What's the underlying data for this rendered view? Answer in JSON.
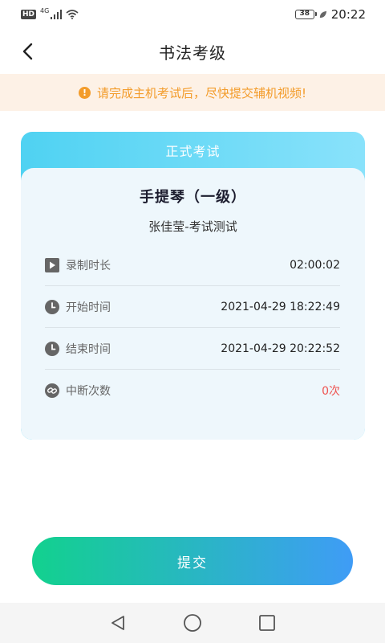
{
  "status_bar": {
    "hd": "HD",
    "network": "4G",
    "battery": "38",
    "time": "20:22"
  },
  "header": {
    "title": "书法考级",
    "back_icon": "chevron-left-icon"
  },
  "notice": {
    "icon": "!",
    "text": "请完成主机考试后，尽快提交辅机视频!",
    "color": "#f39c2b"
  },
  "card": {
    "header_title": "正式考试",
    "subject": "手提琴（一级）",
    "candidate": "张佳莹-考试测试",
    "rows": [
      {
        "icon": "play-icon",
        "label": "录制时长",
        "value": "02:00:02"
      },
      {
        "icon": "clock-icon",
        "label": "开始时间",
        "value": "2021-04-29 18:22:49"
      },
      {
        "icon": "clock-icon",
        "label": "结束时间",
        "value": "2021-04-29 20:22:52"
      },
      {
        "icon": "link-icon",
        "label": "中断次数",
        "value": "0次"
      }
    ]
  },
  "submit": {
    "label": "提交"
  },
  "colors": {
    "accent_orange": "#f39c2b",
    "alert_red": "#ef5350",
    "gradient_start": "#12d18e",
    "gradient_end": "#3f9cf6"
  }
}
